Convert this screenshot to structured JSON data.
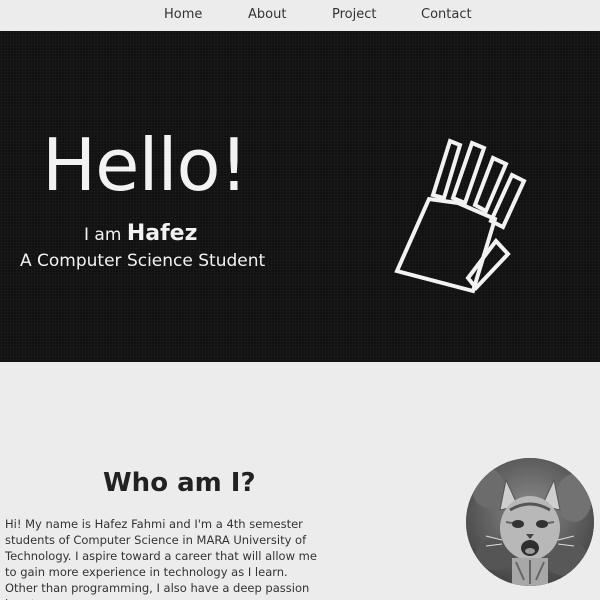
{
  "nav": {
    "items": [
      {
        "label": "Home"
      },
      {
        "label": "About"
      },
      {
        "label": "Project"
      },
      {
        "label": "Contact"
      }
    ]
  },
  "hero": {
    "greeting": "Hello!",
    "intro_prefix": "I am",
    "name": "Hafez",
    "role": "A Computer Science Student",
    "illustration_icon": "waving-hand-icon"
  },
  "about": {
    "title": "Who am I?",
    "paragraphs": [
      "Hi! My name is Hafez Fahmi and I'm a 4th semester students of Computer Science in MARA University of Technology. I aspire toward a career that will allow me to gain more experience in technology as I learn.",
      "Other than programming, I also have a deep passion in art"
    ],
    "photo": "kitten-photo"
  },
  "colors": {
    "hero_background": "#111111",
    "page_background": "#ececec",
    "hero_text": "#f2f2f2"
  }
}
